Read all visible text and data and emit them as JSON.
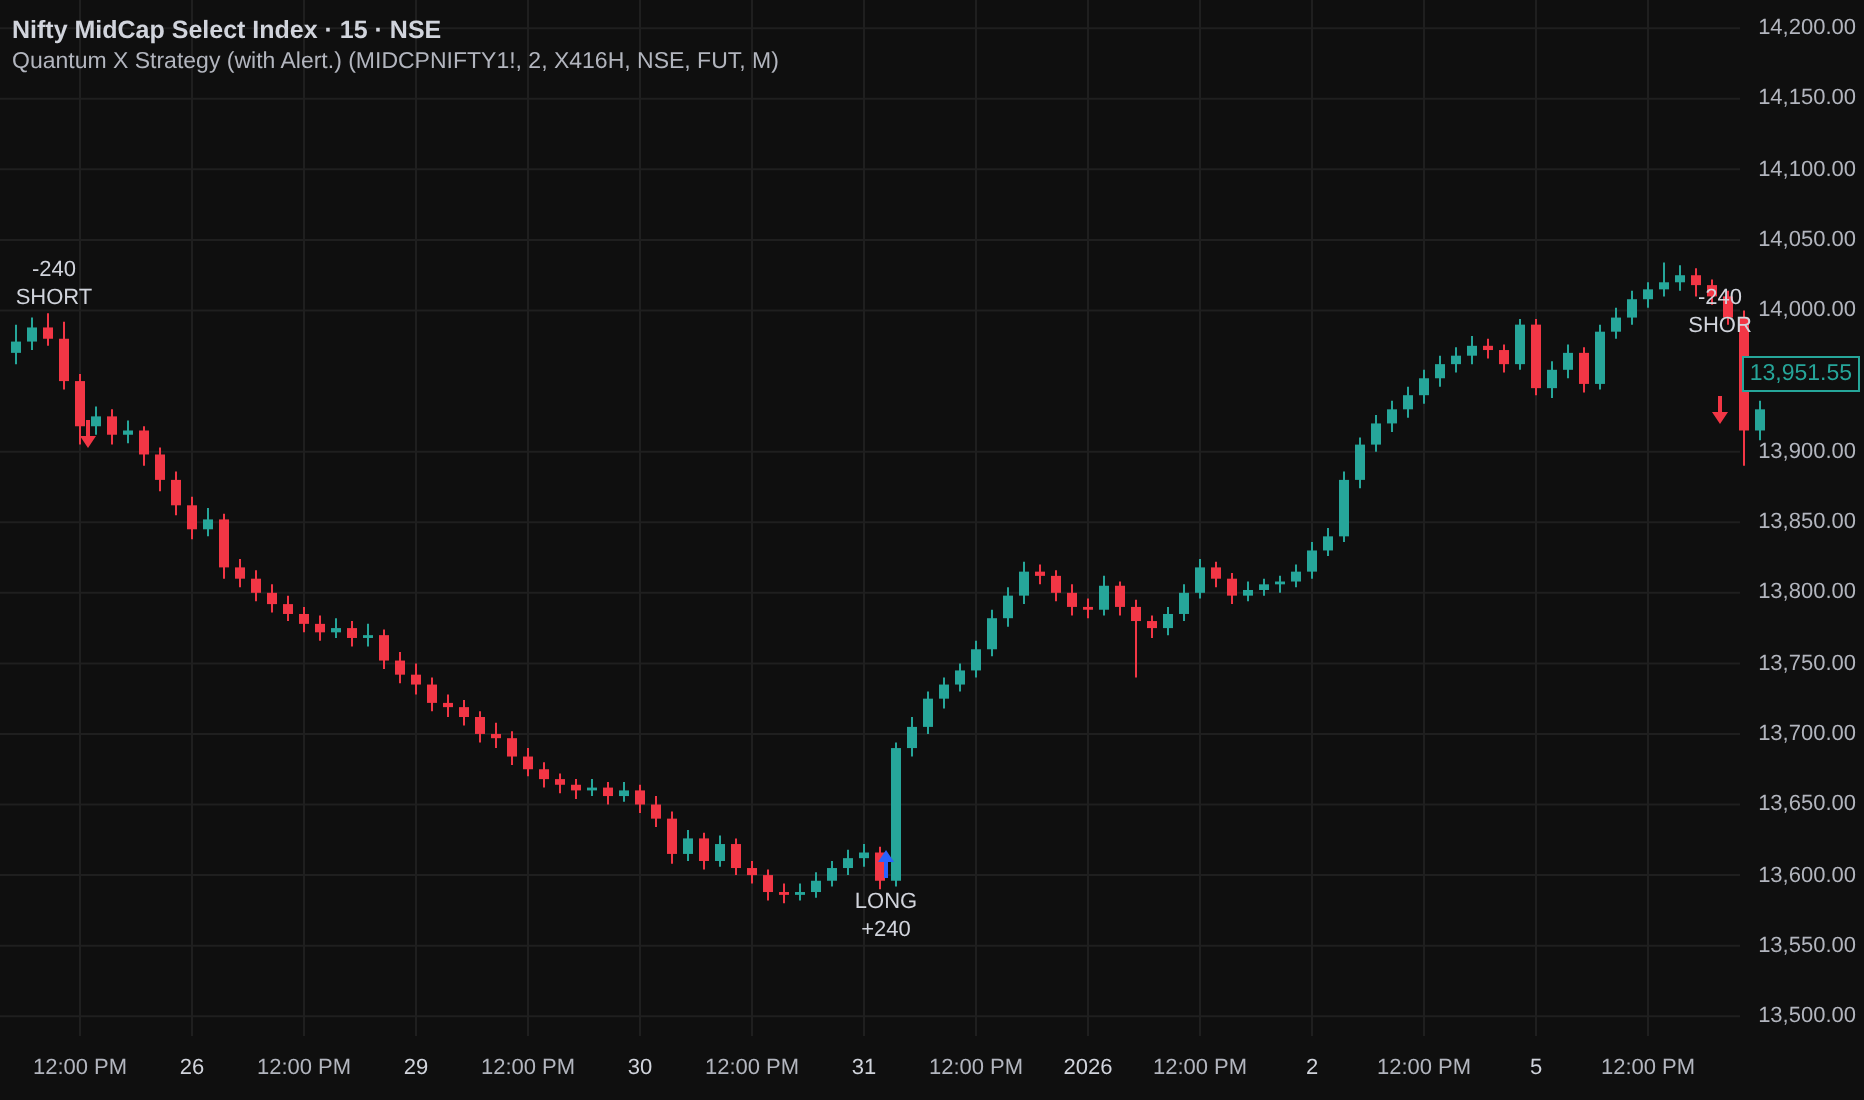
{
  "header": {
    "symbol": "Nifty MidCap Select Index · 15 · NSE",
    "study": "Quantum X Strategy (with Alert.) (MIDCPNIFTY1!, 2, X416H, NSE, FUT, M)"
  },
  "chart": {
    "chart_data": {
      "type": "candlestick",
      "grid": true,
      "ylim": [
        13486,
        14220
      ],
      "categories": [
        null,
        null,
        null,
        null,
        "12:00 PM",
        null,
        null,
        null,
        null,
        null,
        null,
        "26",
        null,
        null,
        null,
        null,
        null,
        null,
        "12:00 PM",
        null,
        null,
        null,
        null,
        null,
        null,
        "29",
        null,
        null,
        null,
        null,
        null,
        null,
        "12:00 PM",
        null,
        null,
        null,
        null,
        null,
        null,
        "30",
        null,
        null,
        null,
        null,
        null,
        null,
        "12:00 PM",
        null,
        null,
        null,
        null,
        null,
        null,
        "31",
        null,
        null,
        null,
        null,
        null,
        null,
        "12:00 PM",
        null,
        null,
        null,
        null,
        null,
        null,
        "2026",
        null,
        null,
        null,
        null,
        null,
        null,
        "12:00 PM",
        null,
        null,
        null,
        null,
        null,
        null,
        "2",
        null,
        null,
        null,
        null,
        null,
        null,
        "12:00 PM",
        null,
        null,
        null,
        null,
        null,
        null,
        "5",
        null,
        null,
        null,
        null,
        null,
        null,
        "12:00 PM",
        null,
        null,
        null,
        null,
        null,
        null,
        null
      ],
      "yticks": [
        {
          "value": 14200,
          "label": "14,200.00"
        },
        {
          "value": 14150,
          "label": "14,150.00"
        },
        {
          "value": 14100,
          "label": "14,100.00"
        },
        {
          "value": 14050,
          "label": "14,050.00"
        },
        {
          "value": 14000,
          "label": "14,000.00"
        },
        {
          "value": 13900,
          "label": "13,900.00"
        },
        {
          "value": 13850,
          "label": "13,850.00"
        },
        {
          "value": 13800,
          "label": "13,800.00"
        },
        {
          "value": 13750,
          "label": "13,750.00"
        },
        {
          "value": 13700,
          "label": "13,700.00"
        },
        {
          "value": 13650,
          "label": "13,650.00"
        },
        {
          "value": 13600,
          "label": "13,600.00"
        },
        {
          "value": 13550,
          "label": "13,550.00"
        },
        {
          "value": 13500,
          "label": "13,500.00"
        }
      ],
      "ohlc": [
        [
          13970,
          13990,
          13962,
          13978
        ],
        [
          13978,
          13995,
          13972,
          13988
        ],
        [
          13988,
          13998,
          13975,
          13980
        ],
        [
          13980,
          13992,
          13944,
          13950
        ],
        [
          13950,
          13955,
          13905,
          13918
        ],
        [
          13918,
          13932,
          13912,
          13925
        ],
        [
          13925,
          13930,
          13905,
          13912
        ],
        [
          13912,
          13922,
          13906,
          13915
        ],
        [
          13915,
          13918,
          13890,
          13898
        ],
        [
          13898,
          13903,
          13872,
          13880
        ],
        [
          13880,
          13886,
          13855,
          13862
        ],
        [
          13862,
          13868,
          13838,
          13845
        ],
        [
          13845,
          13860,
          13840,
          13852
        ],
        [
          13852,
          13856,
          13810,
          13818
        ],
        [
          13818,
          13824,
          13804,
          13810
        ],
        [
          13810,
          13816,
          13794,
          13800
        ],
        [
          13800,
          13806,
          13786,
          13792
        ],
        [
          13792,
          13798,
          13780,
          13785
        ],
        [
          13785,
          13790,
          13772,
          13778
        ],
        [
          13778,
          13784,
          13766,
          13772
        ],
        [
          13772,
          13782,
          13768,
          13775
        ],
        [
          13775,
          13780,
          13762,
          13768
        ],
        [
          13768,
          13778,
          13762,
          13770
        ],
        [
          13770,
          13774,
          13746,
          13752
        ],
        [
          13752,
          13758,
          13736,
          13742
        ],
        [
          13742,
          13750,
          13728,
          13735
        ],
        [
          13735,
          13740,
          13716,
          13722
        ],
        [
          13722,
          13728,
          13712,
          13719
        ],
        [
          13719,
          13724,
          13706,
          13712
        ],
        [
          13712,
          13716,
          13694,
          13700
        ],
        [
          13700,
          13708,
          13690,
          13697
        ],
        [
          13697,
          13702,
          13678,
          13684
        ],
        [
          13684,
          13690,
          13670,
          13675
        ],
        [
          13675,
          13680,
          13662,
          13668
        ],
        [
          13668,
          13672,
          13658,
          13664
        ],
        [
          13664,
          13668,
          13654,
          13660
        ],
        [
          13660,
          13668,
          13656,
          13662
        ],
        [
          13662,
          13666,
          13650,
          13656
        ],
        [
          13656,
          13666,
          13652,
          13660
        ],
        [
          13660,
          13664,
          13644,
          13650
        ],
        [
          13650,
          13656,
          13634,
          13640
        ],
        [
          13640,
          13645,
          13608,
          13615
        ],
        [
          13615,
          13632,
          13610,
          13626
        ],
        [
          13626,
          13630,
          13604,
          13610
        ],
        [
          13610,
          13628,
          13606,
          13622
        ],
        [
          13622,
          13626,
          13600,
          13605
        ],
        [
          13605,
          13610,
          13594,
          13600
        ],
        [
          13600,
          13604,
          13582,
          13588
        ],
        [
          13588,
          13594,
          13580,
          13586
        ],
        [
          13586,
          13594,
          13582,
          13588
        ],
        [
          13588,
          13602,
          13584,
          13596
        ],
        [
          13596,
          13610,
          13592,
          13605
        ],
        [
          13605,
          13618,
          13600,
          13612
        ],
        [
          13612,
          13622,
          13606,
          13616
        ],
        [
          13616,
          13620,
          13590,
          13596
        ],
        [
          13596,
          13694,
          13592,
          13690
        ],
        [
          13690,
          13712,
          13684,
          13705
        ],
        [
          13705,
          13730,
          13700,
          13725
        ],
        [
          13725,
          13740,
          13718,
          13735
        ],
        [
          13735,
          13750,
          13730,
          13745
        ],
        [
          13745,
          13766,
          13740,
          13760
        ],
        [
          13760,
          13788,
          13755,
          13782
        ],
        [
          13782,
          13804,
          13776,
          13798
        ],
        [
          13798,
          13822,
          13792,
          13815
        ],
        [
          13815,
          13820,
          13806,
          13812
        ],
        [
          13812,
          13816,
          13794,
          13800
        ],
        [
          13800,
          13806,
          13784,
          13790
        ],
        [
          13790,
          13796,
          13782,
          13788
        ],
        [
          13788,
          13812,
          13784,
          13805
        ],
        [
          13805,
          13808,
          13784,
          13790
        ],
        [
          13790,
          13795,
          13740,
          13780
        ],
        [
          13780,
          13784,
          13768,
          13775
        ],
        [
          13775,
          13790,
          13770,
          13785
        ],
        [
          13785,
          13806,
          13780,
          13800
        ],
        [
          13800,
          13824,
          13796,
          13818
        ],
        [
          13818,
          13822,
          13804,
          13810
        ],
        [
          13810,
          13814,
          13792,
          13798
        ],
        [
          13798,
          13808,
          13794,
          13802
        ],
        [
          13802,
          13810,
          13798,
          13806
        ],
        [
          13806,
          13812,
          13800,
          13808
        ],
        [
          13808,
          13820,
          13804,
          13815
        ],
        [
          13815,
          13836,
          13810,
          13830
        ],
        [
          13830,
          13846,
          13826,
          13840
        ],
        [
          13840,
          13886,
          13836,
          13880
        ],
        [
          13880,
          13910,
          13874,
          13905
        ],
        [
          13905,
          13926,
          13900,
          13920
        ],
        [
          13920,
          13936,
          13914,
          13930
        ],
        [
          13930,
          13946,
          13924,
          13940
        ],
        [
          13940,
          13958,
          13934,
          13952
        ],
        [
          13952,
          13968,
          13946,
          13962
        ],
        [
          13962,
          13974,
          13956,
          13968
        ],
        [
          13968,
          13982,
          13962,
          13975
        ],
        [
          13975,
          13980,
          13966,
          13972
        ],
        [
          13972,
          13976,
          13956,
          13962
        ],
        [
          13962,
          13994,
          13958,
          13990
        ],
        [
          13990,
          13994,
          13940,
          13945
        ],
        [
          13945,
          13964,
          13938,
          13958
        ],
        [
          13958,
          13976,
          13952,
          13970
        ],
        [
          13970,
          13974,
          13942,
          13948
        ],
        [
          13948,
          13990,
          13944,
          13985
        ],
        [
          13985,
          14002,
          13980,
          13995
        ],
        [
          13995,
          14014,
          13990,
          14008
        ],
        [
          14008,
          14020,
          14002,
          14015
        ],
        [
          14015,
          14034,
          14010,
          14020
        ],
        [
          14020,
          14032,
          14014,
          14025
        ],
        [
          14025,
          14030,
          14010,
          14018
        ],
        [
          14018,
          14022,
          14004,
          14010
        ],
        [
          14010,
          14014,
          13990,
          13995
        ],
        [
          13995,
          14000,
          13890,
          13915
        ],
        [
          13915,
          13936,
          13908,
          13930
        ]
      ]
    },
    "last_price": "13,951.55",
    "signals": [
      {
        "kind": "short",
        "amount": "-240",
        "label": "SHORT"
      },
      {
        "kind": "long",
        "label": "LONG",
        "amount": "+240"
      },
      {
        "kind": "short",
        "amount": "-240",
        "label": "SHOR"
      }
    ]
  }
}
